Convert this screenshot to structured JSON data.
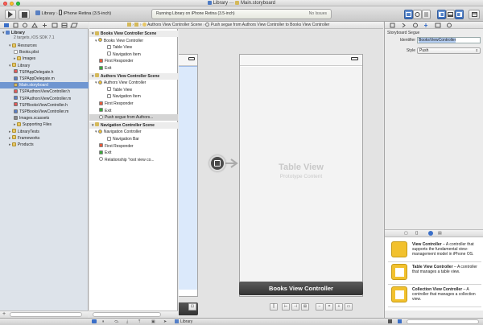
{
  "window": {
    "title": "Library",
    "document": "Main.storyboard"
  },
  "toolbar": {
    "run_icon": "play-icon",
    "stop_icon": "stop-icon",
    "scheme_project": "Library",
    "scheme_device": "iPhone Retina (3.5-inch)",
    "activity_text": "Running Library on iPhone Retina (3.5-inch)",
    "activity_status": "No Issues"
  },
  "jumpbar": {
    "crumbs": [
      "Authors View Controller Scene",
      "Push segue from Authors View Controller to Books View Controller"
    ]
  },
  "navigator": {
    "project": {
      "name": "Library",
      "subtitle": "2 targets, iOS SDK 7.1"
    },
    "items": [
      {
        "label": "Resources",
        "kind": "folder"
      },
      {
        "label": "Books.plist",
        "kind": "file"
      },
      {
        "label": "Images",
        "kind": "folder"
      },
      {
        "label": "Library",
        "kind": "folder"
      },
      {
        "label": "TSPAppDelegate.h",
        "kind": "hfile"
      },
      {
        "label": "TSPAppDelegate.m",
        "kind": "mfile"
      },
      {
        "label": "Main.storyboard",
        "kind": "storyboard",
        "selected": true
      },
      {
        "label": "TSPAuthorsViewController.h",
        "kind": "hfile"
      },
      {
        "label": "TSPAuthorsViewController.m",
        "kind": "mfile"
      },
      {
        "label": "TSPBooksViewController.h",
        "kind": "hfile"
      },
      {
        "label": "TSPBooksViewController.m",
        "kind": "mfile"
      },
      {
        "label": "Images.xcassets",
        "kind": "asset"
      },
      {
        "label": "Supporting Files",
        "kind": "folder"
      },
      {
        "label": "LibraryTests",
        "kind": "folder"
      },
      {
        "label": "Frameworks",
        "kind": "folder"
      },
      {
        "label": "Products",
        "kind": "folder"
      }
    ]
  },
  "outline": {
    "scenes": [
      {
        "title": "Books View Controller Scene",
        "items": [
          "Books View Controller",
          "Table View",
          "Navigation Item",
          "First Responder",
          "Exit"
        ]
      },
      {
        "title": "Authors View Controller Scene",
        "items": [
          "Authors View Controller",
          "Table View",
          "Navigation Item",
          "First Responder",
          "Exit",
          "Push segue from Authors..."
        ]
      },
      {
        "title": "Navigation Controller Scene",
        "items": [
          "Navigation Controller",
          "Navigation Bar",
          "First Responder",
          "Exit",
          "Relationship \"root view co..."
        ]
      }
    ]
  },
  "canvas": {
    "table_view_title": "Table View",
    "table_view_subtitle": "Prototype Content",
    "scene_title": "Books View Controller"
  },
  "inspector": {
    "section_title": "Storyboard Segue",
    "identifier_label": "Identifier",
    "identifier_value": "BooksViewController",
    "style_label": "Style",
    "style_value": "Push"
  },
  "library": {
    "items": [
      {
        "title": "View Controller",
        "desc": " – A controller that supports the fundamental view-management model in iPhone OS.",
        "color": "#f2c12e"
      },
      {
        "title": "Table View Controller",
        "desc": " – A controller that manages a table view.",
        "color": "#f2c12e"
      },
      {
        "title": "Collection View Controller",
        "desc": " – A controller that manages a collection view.",
        "color": "#f2c12e"
      }
    ]
  },
  "statusbar": {
    "path": "Library"
  },
  "colors": {
    "accent": "#3a6fc8",
    "selection": "#6f96d1"
  }
}
